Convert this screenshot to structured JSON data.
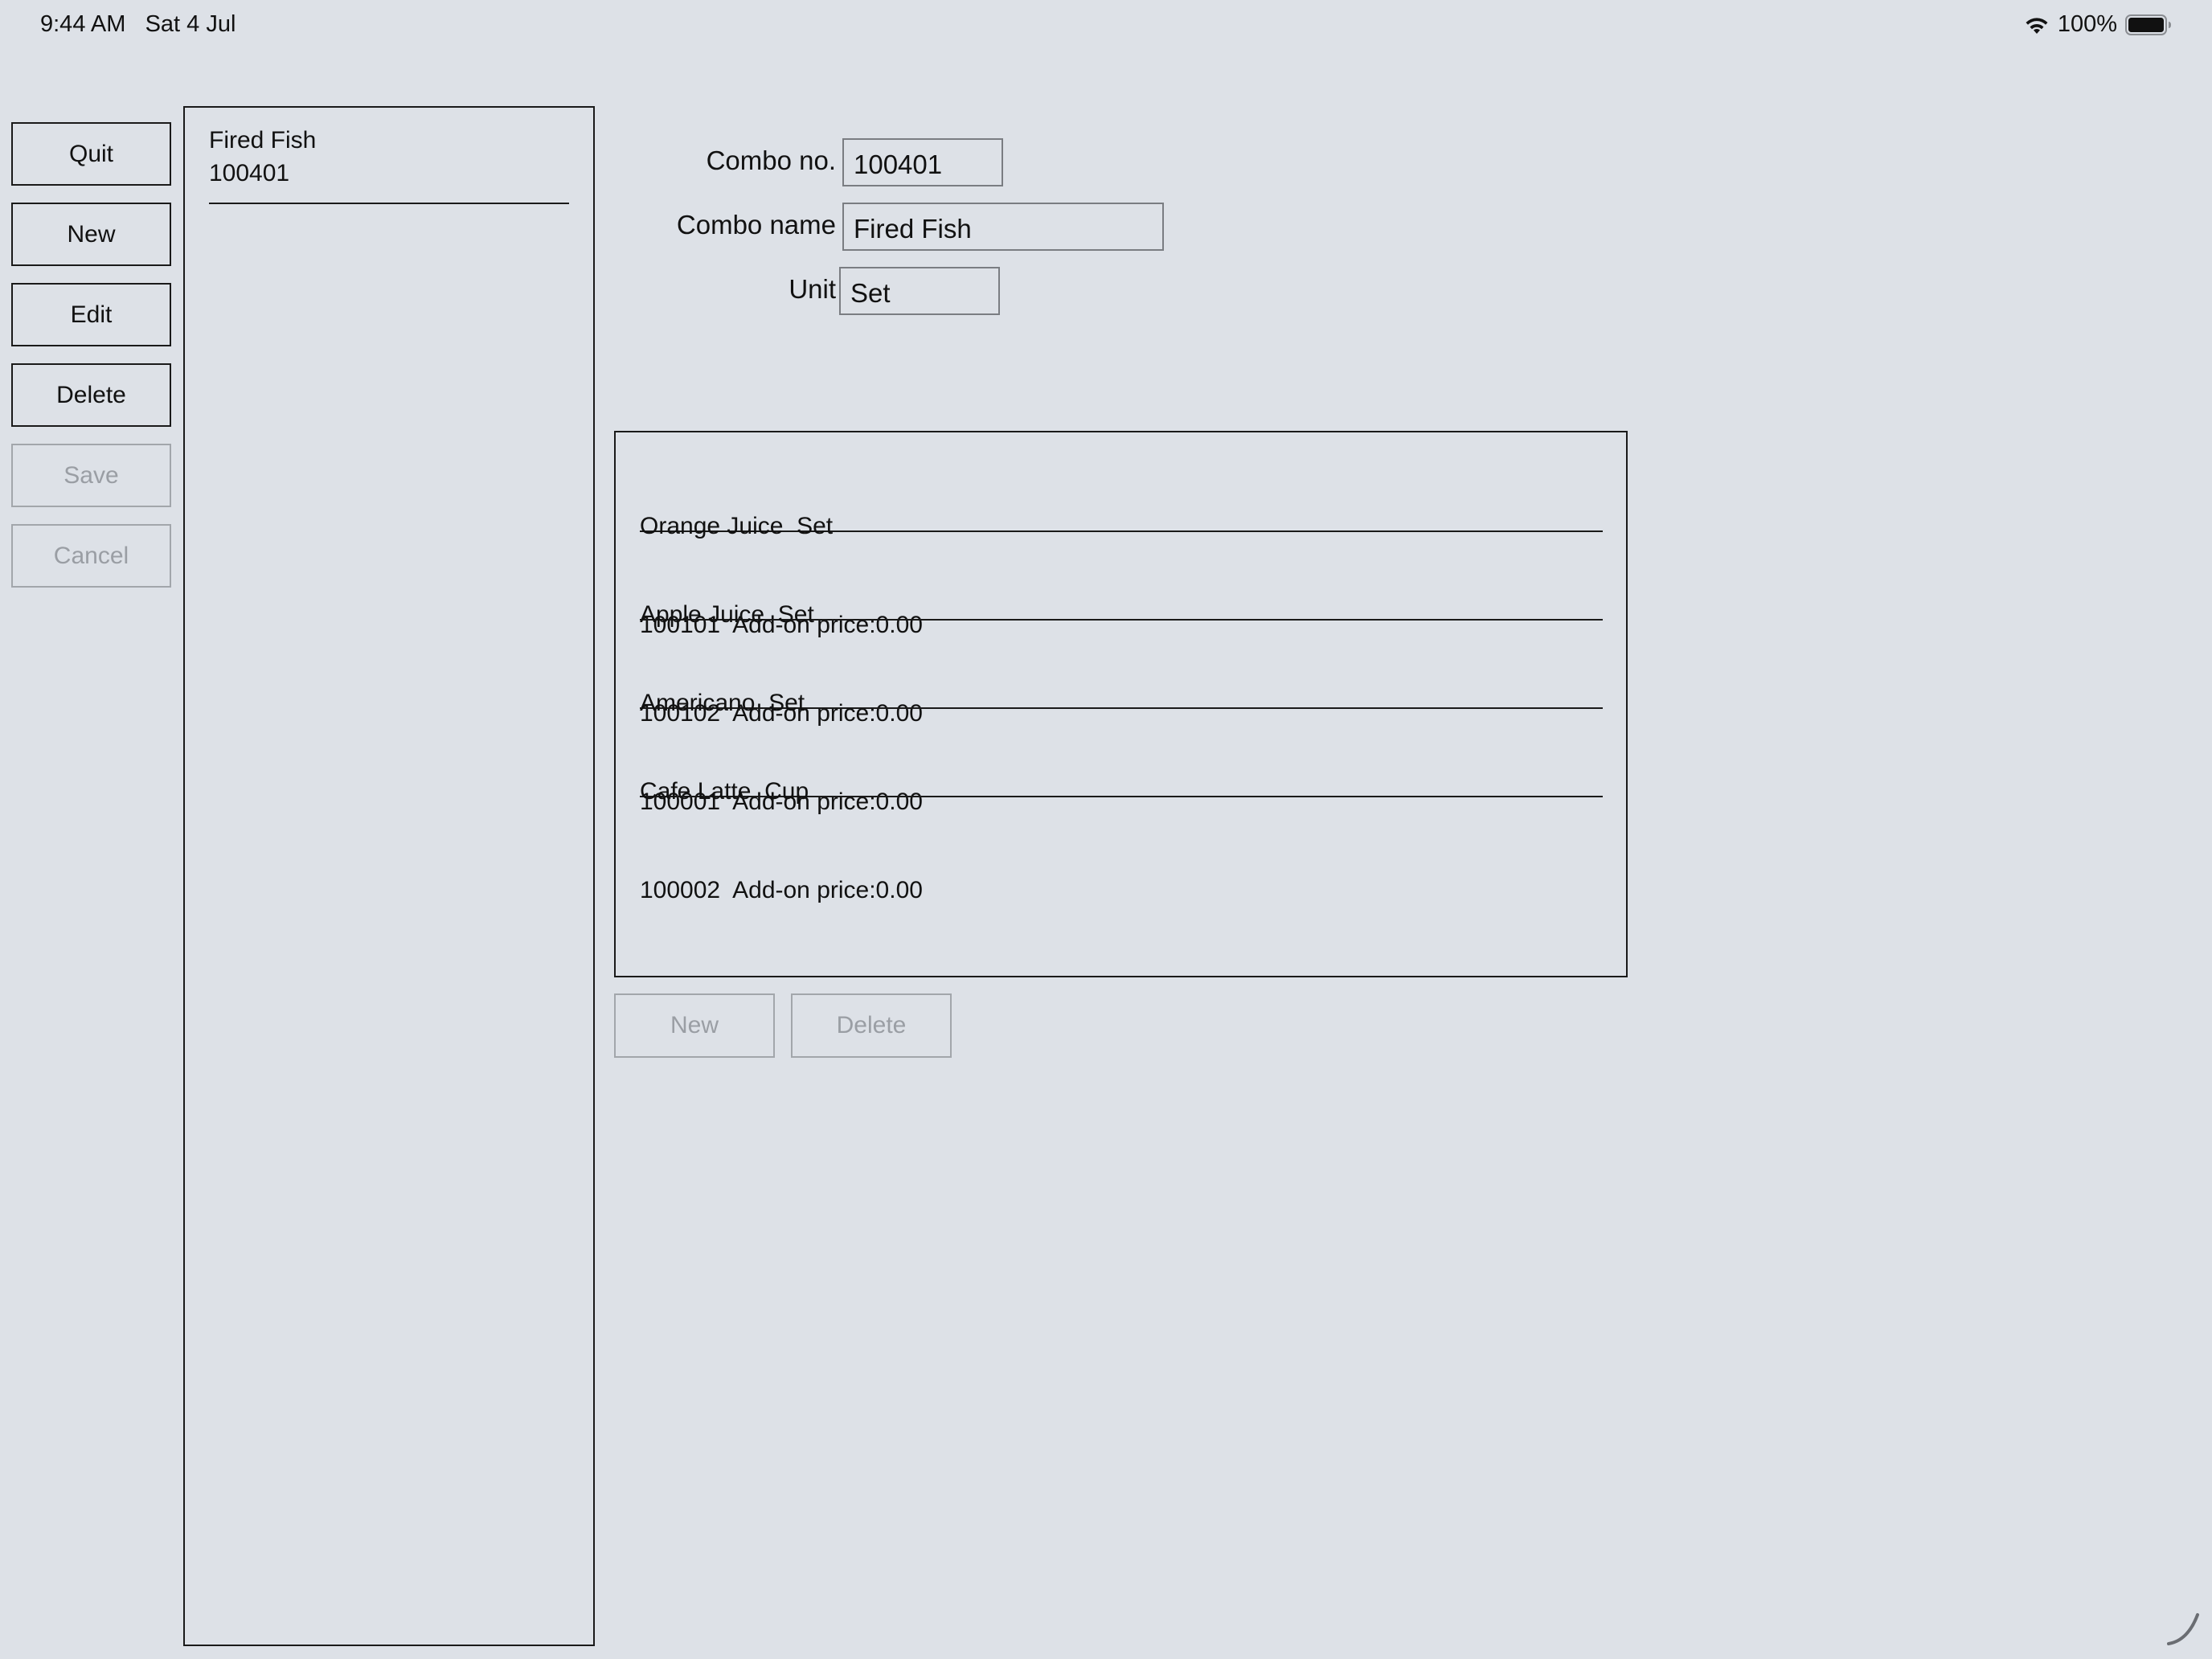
{
  "status_bar": {
    "time": "9:44 AM",
    "date": "Sat 4 Jul",
    "battery": "100%",
    "wifi_icon": "wifi-icon",
    "battery_icon": "battery-full-icon"
  },
  "sidebar": {
    "buttons": [
      {
        "label": "Quit",
        "enabled": true
      },
      {
        "label": "New",
        "enabled": true
      },
      {
        "label": "Edit",
        "enabled": true
      },
      {
        "label": "Delete",
        "enabled": true
      },
      {
        "label": "Save",
        "enabled": false
      },
      {
        "label": "Cancel",
        "enabled": false
      }
    ]
  },
  "combo_list": {
    "items": [
      {
        "name": "Fired Fish",
        "code": "100401"
      }
    ]
  },
  "form": {
    "combo_no_label": "Combo no.",
    "combo_no_value": "100401",
    "combo_name_label": "Combo name",
    "combo_name_value": "Fired Fish",
    "unit_label": "Unit",
    "unit_value": "Set"
  },
  "components": {
    "items": [
      {
        "title": "Orange Juice  Set",
        "detail": "100101  Add-on price:0.00"
      },
      {
        "title": "Apple Juice  Set",
        "detail": "100102  Add-on price:0.00"
      },
      {
        "title": "Americano  Set",
        "detail": "100001  Add-on price:0.00"
      },
      {
        "title": "Cafe Latte  Cup",
        "detail": "100002  Add-on price:0.00"
      }
    ],
    "new_label": "New",
    "delete_label": "Delete"
  },
  "colors": {
    "background": "#dde1e7",
    "border": "#1a1a1a",
    "disabled_text": "#9a9ea4"
  }
}
